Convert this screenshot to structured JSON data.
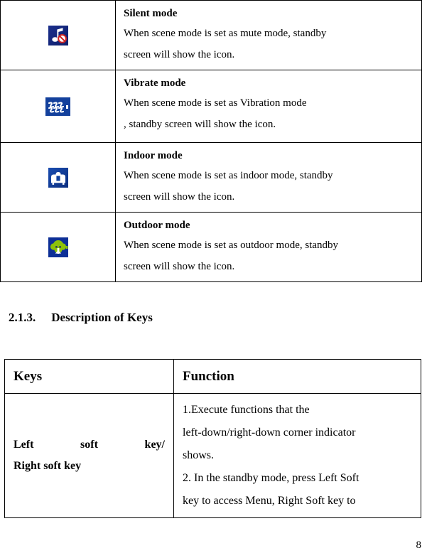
{
  "document": {
    "page_number": "8",
    "section_heading": {
      "number": "2.1.3.",
      "title": "Description of Keys"
    }
  },
  "icon_table": {
    "rows": [
      {
        "icon_name": "silent-mode-icon",
        "icon_colors": {
          "background": "#12267a",
          "note": "#ffffff",
          "prohibition": "#cc2222"
        },
        "title": "Silent mode",
        "description": "When scene mode is set as mute mode, standby screen will show the icon.",
        "line1": "When  scene  mode  is  set  as  mute  mode,  standby",
        "line2": "screen will show the icon."
      },
      {
        "icon_name": "vibrate-mode-icon",
        "icon_colors": {
          "background": "#13409c",
          "waves": "#ffffff"
        },
        "title": "Vibrate mode",
        "description": "When scene mode is set as Vibration mode , standby screen will show the icon.",
        "line1": "When scene mode is set as Vibration mode",
        "line2": ", standby screen will show the icon."
      },
      {
        "icon_name": "indoor-mode-icon",
        "icon_colors": {
          "background": "#0f3f9e",
          "shape": "#ffffff"
        },
        "title": "Indoor mode",
        "description": "When scene mode is set as indoor mode, standby screen will show the icon.",
        "line1": "When  scene  mode  is  set  as  indoor  mode,  standby",
        "line2": "screen will show the icon."
      },
      {
        "icon_name": "outdoor-mode-icon",
        "icon_colors": {
          "background": "#0d2f96",
          "tree": "#8dc20a",
          "trunk": "#ffffff"
        },
        "title": "Outdoor mode",
        "description": "When scene mode is set as outdoor mode, standby screen will show the icon.",
        "line1": "When  scene  mode  is  set  as  outdoor  mode,  standby",
        "line2": "screen will show the icon."
      }
    ]
  },
  "keys_table": {
    "headers": {
      "keys": "Keys",
      "function": "Function"
    },
    "rows": [
      {
        "key_line1": "Left soft key/",
        "key_line2": "Right soft key",
        "function_item_1_line1": "1.Execute functions that the",
        "function_item_1_line2": "left-down/right-down corner indicator",
        "function_item_1_line3": "shows.",
        "function_item_2_line1": "2. In the standby mode, press Left Soft",
        "function_item_2_line2": "key to access Menu, Right Soft key to"
      }
    ]
  }
}
